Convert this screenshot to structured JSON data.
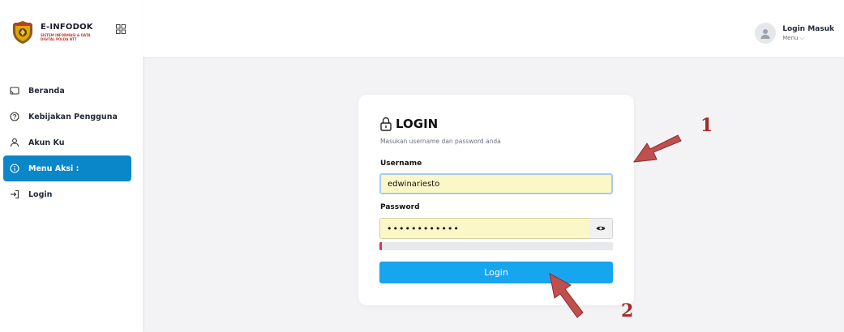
{
  "brand": {
    "title": "E-INFODOK",
    "subtitle": "SISTEM INFORMASI & DATA DIGITAL POLDA NTT"
  },
  "sidebar": {
    "items": [
      {
        "label": "Beranda",
        "icon": "cast-icon"
      },
      {
        "label": "Kebijakan Pengguna",
        "icon": "help-circle-icon"
      },
      {
        "label": "Akun Ku",
        "icon": "user-icon"
      },
      {
        "label": "Menu Aksi :",
        "icon": "info-icon",
        "active": true
      },
      {
        "label": "Login",
        "icon": "login-icon"
      }
    ]
  },
  "header": {
    "user_name": "Login Masuk",
    "user_menu": "Menu ⌵"
  },
  "login": {
    "title": "LOGIN",
    "subtitle": "Masukan username dan password anda",
    "username_label": "Username",
    "username_value": "edwinariesto",
    "password_label": "Password",
    "password_value": "••••••••••••",
    "password_strength": 0.01,
    "button_label": "Login"
  },
  "annotations": {
    "marker_1": "1",
    "marker_2": "2"
  },
  "colors": {
    "accent": "#0a87c9",
    "button": "#18a5ef",
    "annotation": "#a52a2a",
    "autofill": "#fbf7c7"
  }
}
